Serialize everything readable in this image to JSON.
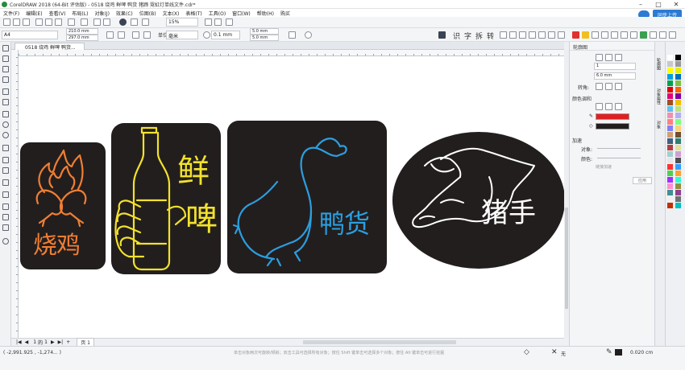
{
  "window": {
    "title": "CorelDRAW 2018 (64-Bit 评估版) - 0518 烧鸡 鲜啤 鸭货 猪蹄 霓虹灯单线文件.cdr*",
    "controls": [
      "–",
      "□",
      "✕"
    ]
  },
  "menu": [
    "文件(F)",
    "编辑(E)",
    "查看(V)",
    "布局(L)",
    "对象(J)",
    "效果(C)",
    "位图(B)",
    "文本(X)",
    "表格(T)",
    "工具(O)",
    "窗口(W)",
    "帮助(H)",
    "购买"
  ],
  "cloud": {
    "upload_label": "同步上传"
  },
  "toolbar": {
    "zoom": "15%",
    "page_size": "A4",
    "width": "210.0 mm",
    "height": "297.0 mm",
    "units_label": "单位",
    "units": "毫米",
    "nudge": "0.1 mm",
    "dup_x": "5.0 mm",
    "dup_y": "5.0 mm",
    "text_tools": [
      "识",
      "字",
      "拆",
      "转"
    ]
  },
  "document_tab": {
    "label": "0518 烧鸡 鲜啤 鸭货..."
  },
  "canvas": {
    "signs": [
      {
        "label": "烧鸡",
        "color": "#f07f33"
      },
      {
        "label_top": "鲜",
        "label_bottom": "啤",
        "color": "#f2e22c"
      },
      {
        "label": "鸭货",
        "color": "#2a9fe0"
      },
      {
        "label": "猪手",
        "color": "#ffffff"
      }
    ],
    "sign_background": "#231e1e"
  },
  "page_nav": {
    "current": "1",
    "of_label": "的",
    "total": "1",
    "page_tab": "页 1"
  },
  "docker": {
    "title": "轮廓图",
    "steps": "1",
    "offset": "6.0 mm",
    "corner_label": "转角:",
    "color_section": "颜色调和",
    "accel_section": "加速",
    "object_label": "对象:",
    "color_label": "颜色:",
    "link_label": "链接加速",
    "apply_label": "应用",
    "outline_color": "#e02020",
    "fill_color": "#231e1e",
    "tabs": [
      "轮廓图",
      "对象属性",
      "对象"
    ]
  },
  "status": {
    "coords": "( -2,991.925 , -1,274... )",
    "hint": "单击对象两次可旋转/倾斜；双击工具可选择所有对象；按住 Shift 键单击可选择多个对象；按住 Alt 键单击可进行挖掘",
    "fill_none": "无",
    "outline_width": "0.020 cm"
  },
  "palette_colors": [
    "#ffffff",
    "#000000",
    "#c8c8c8",
    "#9a9a9a",
    "#ffff00",
    "#e8f000",
    "#00a0e0",
    "#0070c0",
    "#00a050",
    "#80c040",
    "#e00000",
    "#ff6000",
    "#e0007a",
    "#8000a0",
    "#a05020",
    "#f0c000",
    "#60c0f0",
    "#c0e080",
    "#f090b0",
    "#b0b0f0",
    "#ff8080",
    "#80ff80",
    "#8080ff",
    "#ffd080",
    "#d0a070",
    "#705030",
    "#406080",
    "#308070",
    "#b04040",
    "#e0e0a0",
    "#a0d0d0",
    "#d0a0d0",
    "#e6e6e6",
    "#505050",
    "#ff3030",
    "#30a0ff",
    "#50d050",
    "#ffa030",
    "#a030ff",
    "#30ffd0",
    "#ff90d0",
    "#909040",
    "#409090",
    "#904090",
    "#f0f0f0",
    "#707070",
    "#c03000",
    "#00c0c0"
  ]
}
